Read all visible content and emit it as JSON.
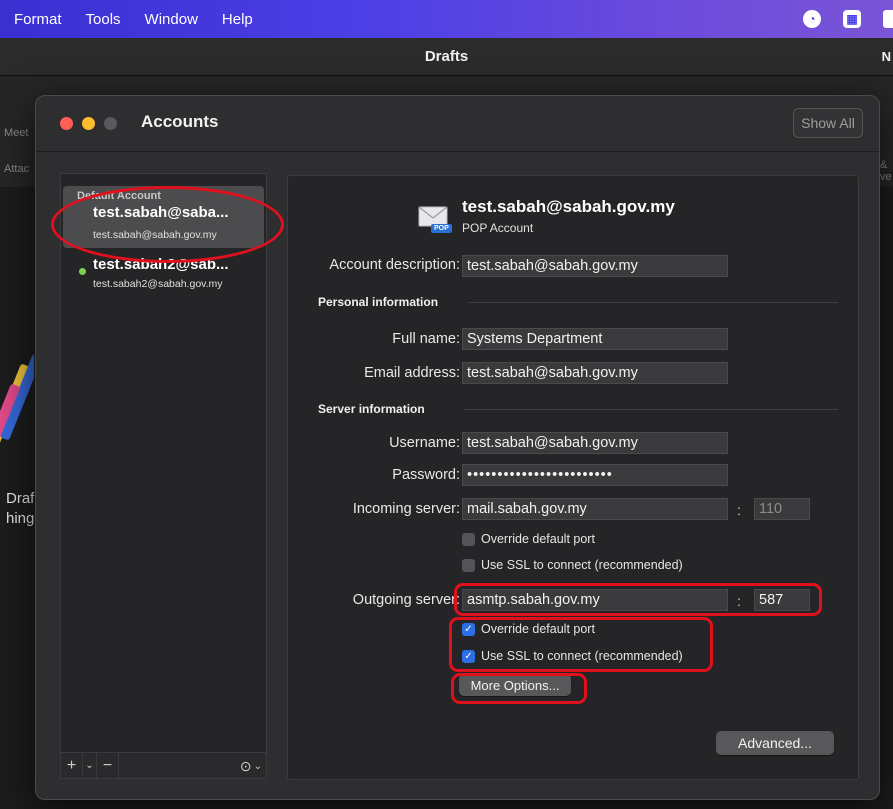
{
  "menubar": {
    "items": [
      "Format",
      "Tools",
      "Window",
      "Help"
    ],
    "tray_icons": [
      "speedometer-icon",
      "grid-icon",
      "control-center-icon"
    ],
    "accent": "#4b3fe6"
  },
  "background_window": {
    "title": "Drafts",
    "edge_text_right": "N",
    "ghost_meet": "Meet",
    "ghost_attach": "Attac",
    "ghost_amp": "&",
    "ghost_ve": "ve",
    "ghost_drafts": "Draf",
    "ghost_thing": "hing"
  },
  "dialog": {
    "title": "Accounts",
    "show_all": "Show All",
    "traffic_colors": [
      "#ff5f57",
      "#febc2e",
      "#5a5a5c"
    ]
  },
  "accounts": {
    "group_label": "Default Account",
    "items": [
      {
        "name": "test.sabah@saba...",
        "email": "test.sabah@sabah.gov.my",
        "selected": true
      },
      {
        "name": "test.sabah2@sab...",
        "email": "test.sabah2@sabah.gov.my",
        "selected": false
      }
    ],
    "footer": {
      "add": "+",
      "add_menu": "⌄",
      "remove": "−",
      "more": "⊙",
      "more_menu": "⌄"
    }
  },
  "detail": {
    "header_email": "test.sabah@sabah.gov.my",
    "header_type": "POP Account",
    "pop_badge": "POP",
    "account_description_label": "Account description:",
    "account_description": "test.sabah@sabah.gov.my",
    "personal_section": "Personal information",
    "full_name_label": "Full name:",
    "full_name": "Systems Department",
    "email_label": "Email address:",
    "email": "test.sabah@sabah.gov.my",
    "server_section": "Server information",
    "username_label": "Username:",
    "username": "test.sabah@sabah.gov.my",
    "password_label": "Password:",
    "password": "••••••••••••••••••••••••",
    "incoming_label": "Incoming server:",
    "incoming_server": "mail.sabah.gov.my",
    "incoming_port": "110",
    "incoming_override": {
      "label": "Override default port",
      "checked": false
    },
    "incoming_ssl": {
      "label": "Use SSL to connect (recommended)",
      "checked": false
    },
    "outgoing_label": "Outgoing server:",
    "outgoing_server": "asmtp.sabah.gov.my",
    "outgoing_port": "587",
    "outgoing_override": {
      "label": "Override default port",
      "checked": true
    },
    "outgoing_ssl": {
      "label": "Use SSL to connect (recommended)",
      "checked": true
    },
    "port_colon": ":",
    "more_options": "More Options...",
    "advanced": "Advanced..."
  },
  "annotation_color": "#e0101c"
}
